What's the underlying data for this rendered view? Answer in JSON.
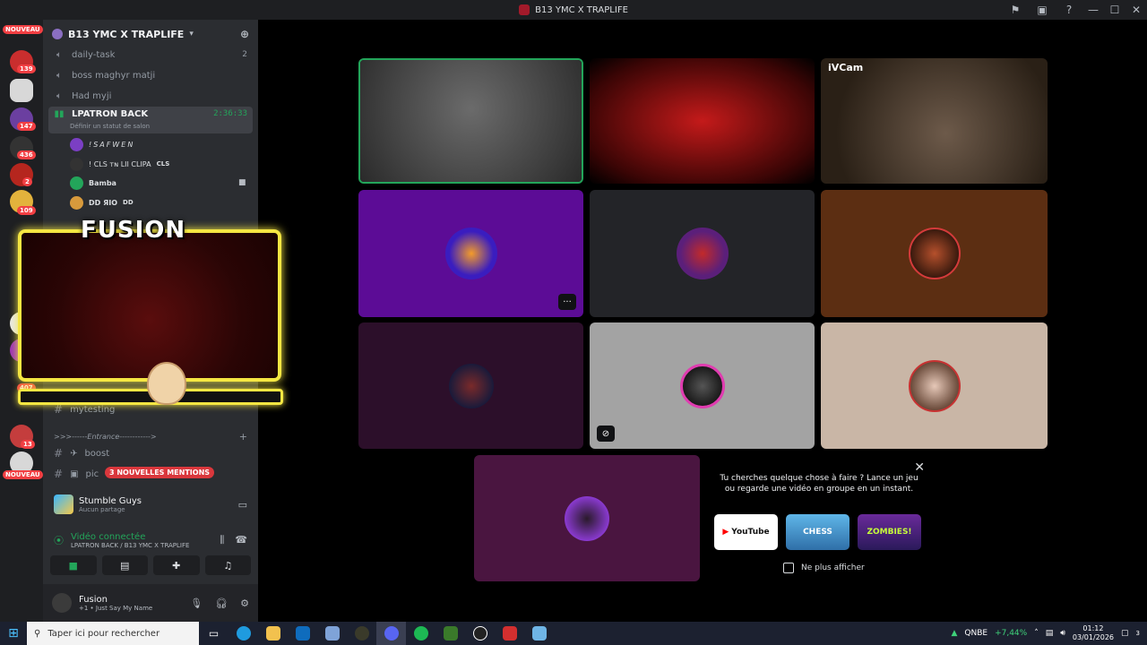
{
  "window": {
    "title": "B13 YMC X TRAPLIFE",
    "controls": [
      "inbox-icon",
      "updates-icon",
      "help-icon",
      "minimize",
      "maximize",
      "close"
    ]
  },
  "guilds": {
    "nouveau_top": "NOUVEAU",
    "badges": [
      "20",
      "139",
      "147",
      "436",
      "2",
      "109",
      "407",
      "13"
    ],
    "nouveau_bottom": "NOUVEAU"
  },
  "sidebar": {
    "server_name": "B13 YMC X TRAPLIFE",
    "channels": [
      {
        "name": "daily-task",
        "count": "2"
      },
      {
        "name": "boss maghyr matji"
      },
      {
        "name": "Had myji"
      }
    ],
    "active_channel": {
      "name": "LPATRON BACK",
      "timer": "2:36:33",
      "status": "Définir un statut de salon"
    },
    "members": [
      {
        "name": "!SAFWEN"
      },
      {
        "name": "! CLS ᴛɴ LII CLIPA",
        "tag": "CLS"
      },
      {
        "name": "Bamba"
      },
      {
        "name": "DD ЯIO",
        "tag": "DD"
      }
    ],
    "text_channels": [
      {
        "name": "mytesting"
      },
      {
        "name": ">>>------Entrance------------>"
      },
      {
        "name": "boost"
      },
      {
        "name": "pic"
      }
    ],
    "mentions_pill": "3 NOUVELLES MENTIONS"
  },
  "activity": {
    "game": "Stumble Guys",
    "sub": "Aucun partage"
  },
  "voice": {
    "status": "Vidéo connectée",
    "location": "LPATRON BACK / B13 YMC X TRAPLIFE"
  },
  "user": {
    "name": "Fusion",
    "status": "Just Say My Name",
    "status_prefix": "+1 •"
  },
  "overlay": {
    "title": "FUSION"
  },
  "grid": {
    "tiles": [
      {
        "label": "",
        "bg": "#3a3a3a"
      },
      {
        "label": "",
        "bg": "#5a0b0b"
      },
      {
        "label": "iVCam",
        "bg": "#2a2520"
      },
      {
        "label": "",
        "bg": "#5c0c96"
      },
      {
        "label": "",
        "bg": "#232428"
      },
      {
        "label": "",
        "bg": "#5c2e12"
      },
      {
        "label": "",
        "bg": "#2c0f2a"
      },
      {
        "label": "",
        "bg": "#a3a3a3"
      },
      {
        "label": "",
        "bg": "#c9b6a6"
      },
      {
        "label": "",
        "bg": "#4a1540"
      }
    ],
    "more_label": "···"
  },
  "suggestion": {
    "message": "Tu cherches quelque chose à faire ? Lance un jeu ou regarde une vidéo en groupe en un instant.",
    "apps": [
      "YouTube",
      "CHESS",
      "ZOMBIES!"
    ],
    "dont_show": "Ne plus afficher"
  },
  "taskbar": {
    "search_placeholder": "Taper ici pour rechercher",
    "stock_symbol": "QNBE",
    "stock_change": "+7,44%",
    "time": "01:12",
    "date": "03/01/2026",
    "notif_count": "3"
  }
}
